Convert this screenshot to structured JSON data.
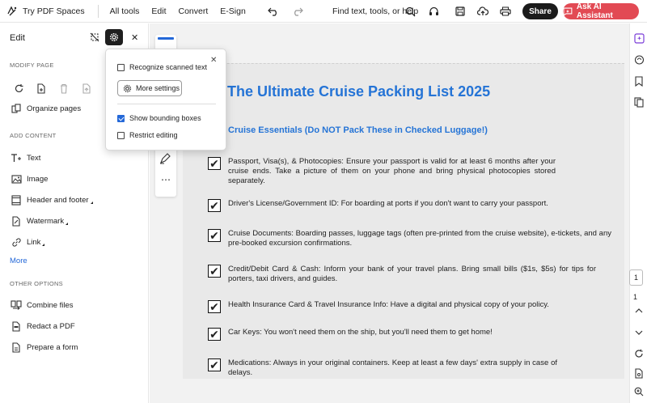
{
  "topbar": {
    "brand": "Try PDF Spaces",
    "menu": [
      "All tools",
      "Edit",
      "Convert",
      "E-Sign"
    ],
    "search_text": "Find text, tools, or help",
    "share_label": "Share",
    "ai_label": "Ask AI Assistant",
    "ai_color": "#e24a54"
  },
  "left_panel": {
    "title": "Edit",
    "modify_page_label": "MODIFY PAGE",
    "organize_pages": "Organize pages",
    "add_content_label": "ADD CONTENT",
    "add_content_items": [
      "Text",
      "Image",
      "Header and footer",
      "Watermark",
      "Link"
    ],
    "more_label": "More",
    "other_options_label": "OTHER OPTIONS",
    "other_items": [
      "Combine files",
      "Redact a PDF",
      "Prepare a form"
    ]
  },
  "popup": {
    "recognize_scanned": "Recognize scanned text",
    "recognize_checked": false,
    "more_settings": "More settings",
    "show_bounding": "Show bounding boxes",
    "show_bounding_checked": true,
    "restrict_editing": "Restrict editing",
    "restrict_checked": false
  },
  "document": {
    "title": "The Ultimate Cruise Packing List 2025",
    "subtitle": "Cruise Essentials (Do NOT Pack These in Checked Luggage!)",
    "accent_color": "#2574d6",
    "items": [
      "Passport, Visa(s), & Photocopies: Ensure your passport is valid for at least 6 months after your cruise ends. Take a picture of them on your phone and bring physical photocopies stored separately.",
      "Driver's License/Government ID: For boarding at ports if you don't want to carry your passport.",
      "Cruise Documents: Boarding passes, luggage tags (often pre-printed from the cruise website), e-tickets, and any pre-booked excursion confirmations.",
      "Credit/Debit Card & Cash: Inform your bank of your travel plans. Bring small bills ($1s, $5s) for tips for porters, taxi drivers, and guides.",
      "Health Insurance Card & Travel Insurance Info: Have a digital and physical copy of your policy.",
      "Car Keys: You won't need them on the ship, but you'll need them to get home!",
      "Medications: Always in your original containers. Keep at least a few days' extra supply in case of delays."
    ],
    "check_mark": "✔"
  },
  "pager": {
    "current": "1",
    "total": "1"
  }
}
